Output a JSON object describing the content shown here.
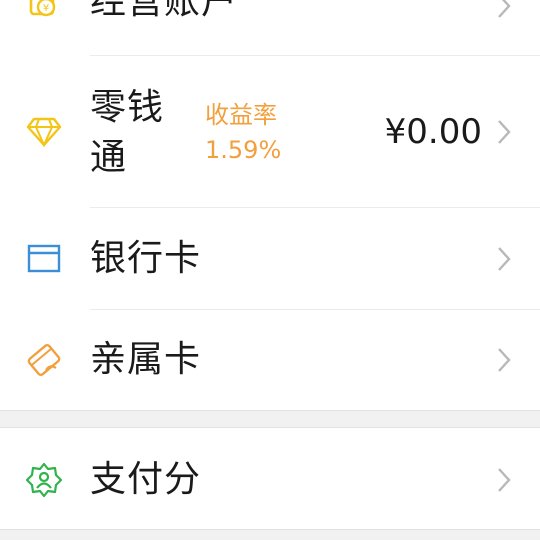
{
  "colors": {
    "gold": "#f3c516",
    "blue": "#3b8fd6",
    "orange": "#f2a03d",
    "green": "#2fb34a",
    "chevron": "#b8b8b8"
  },
  "rows": [
    {
      "label": "经营账户",
      "icon": "business-account-icon"
    },
    {
      "label_line1": "零钱",
      "label_line2": "通",
      "yield_label": "收益率",
      "yield_value": "1.59%",
      "balance": "¥0.00",
      "icon": "diamond-icon"
    },
    {
      "label": "银行卡",
      "icon": "bank-card-icon"
    },
    {
      "label": "亲属卡",
      "icon": "family-card-icon"
    },
    {
      "label": "支付分",
      "icon": "pay-score-icon"
    }
  ]
}
